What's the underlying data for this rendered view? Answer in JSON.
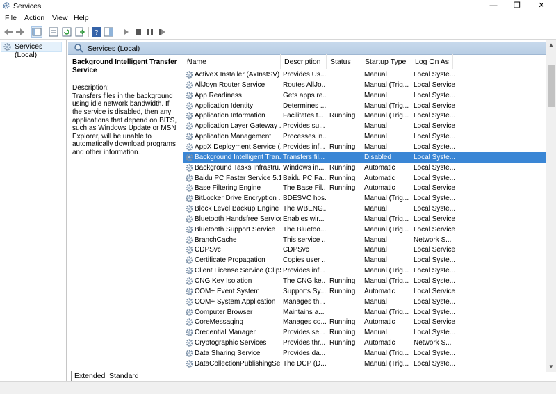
{
  "window": {
    "title": "Services",
    "minimize": "—",
    "restore": "❐",
    "close": "✕"
  },
  "menu": [
    "File",
    "Action",
    "View",
    "Help"
  ],
  "tree": {
    "root_label": "Services (Local)"
  },
  "panel": {
    "header": "Services (Local)",
    "selected_service": "Background Intelligent Transfer Service",
    "description_label": "Description:",
    "description": "Transfers files in the background using idle network bandwidth. If the service is disabled, then any applications that depend on BITS, such as Windows Update or MSN Explorer, will be unable to automatically download programs and other information."
  },
  "columns": [
    "Name",
    "Description",
    "Status",
    "Startup Type",
    "Log On As"
  ],
  "rows": [
    [
      "ActiveX Installer (AxInstSV)",
      "Provides Us...",
      "",
      "Manual",
      "Local Syste..."
    ],
    [
      "AllJoyn Router Service",
      "Routes AllJo...",
      "",
      "Manual (Trig...",
      "Local Service"
    ],
    [
      "App Readiness",
      "Gets apps re...",
      "",
      "Manual",
      "Local Syste..."
    ],
    [
      "Application Identity",
      "Determines ...",
      "",
      "Manual (Trig...",
      "Local Service"
    ],
    [
      "Application Information",
      "Facilitates t...",
      "Running",
      "Manual (Trig...",
      "Local Syste..."
    ],
    [
      "Application Layer Gateway ...",
      "Provides su...",
      "",
      "Manual",
      "Local Service"
    ],
    [
      "Application Management",
      "Processes in...",
      "",
      "Manual",
      "Local Syste..."
    ],
    [
      "AppX Deployment Service (...",
      "Provides inf...",
      "Running",
      "Manual",
      "Local Syste..."
    ],
    [
      "Background Intelligent Tran...",
      "Transfers fil...",
      "",
      "Disabled",
      "Local Syste..."
    ],
    [
      "Background Tasks Infrastru...",
      "Windows in...",
      "Running",
      "Automatic",
      "Local Syste..."
    ],
    [
      "Baidu PC Faster Service 5.1...",
      "Baidu PC Fa...",
      "Running",
      "Automatic",
      "Local Syste..."
    ],
    [
      "Base Filtering Engine",
      "The Base Fil...",
      "Running",
      "Automatic",
      "Local Service"
    ],
    [
      "BitLocker Drive Encryption ...",
      "BDESVC hos...",
      "",
      "Manual (Trig...",
      "Local Syste..."
    ],
    [
      "Block Level Backup Engine ...",
      "The WBENG...",
      "",
      "Manual",
      "Local Syste..."
    ],
    [
      "Bluetooth Handsfree Service",
      "Enables wir...",
      "",
      "Manual (Trig...",
      "Local Service"
    ],
    [
      "Bluetooth Support Service",
      "The Bluetoo...",
      "",
      "Manual (Trig...",
      "Local Service"
    ],
    [
      "BranchCache",
      "This service ...",
      "",
      "Manual",
      "Network S..."
    ],
    [
      "CDPSvc",
      "CDPSvc",
      "",
      "Manual",
      "Local Service"
    ],
    [
      "Certificate Propagation",
      "Copies user ...",
      "",
      "Manual",
      "Local Syste..."
    ],
    [
      "Client License Service (ClipS...",
      "Provides inf...",
      "",
      "Manual (Trig...",
      "Local Syste..."
    ],
    [
      "CNG Key Isolation",
      "The CNG ke...",
      "Running",
      "Manual (Trig...",
      "Local Syste..."
    ],
    [
      "COM+ Event System",
      "Supports Sy...",
      "Running",
      "Automatic",
      "Local Service"
    ],
    [
      "COM+ System Application",
      "Manages th...",
      "",
      "Manual",
      "Local Syste..."
    ],
    [
      "Computer Browser",
      "Maintains a...",
      "",
      "Manual (Trig...",
      "Local Syste..."
    ],
    [
      "CoreMessaging",
      "Manages co...",
      "Running",
      "Automatic",
      "Local Service"
    ],
    [
      "Credential Manager",
      "Provides se...",
      "Running",
      "Manual",
      "Local Syste..."
    ],
    [
      "Cryptographic Services",
      "Provides thr...",
      "Running",
      "Automatic",
      "Network S..."
    ],
    [
      "Data Sharing Service",
      "Provides da...",
      "",
      "Manual (Trig...",
      "Local Syste..."
    ],
    [
      "DataCollectionPublishingSe...",
      "The DCP (D...",
      "",
      "Manual (Trig...",
      "Local Syste..."
    ]
  ],
  "selected_row_index": 8,
  "tabs": [
    "Extended",
    "Standard"
  ],
  "colors": {
    "selection": "#3a86d5",
    "header_bar": "#c7d9ec"
  }
}
